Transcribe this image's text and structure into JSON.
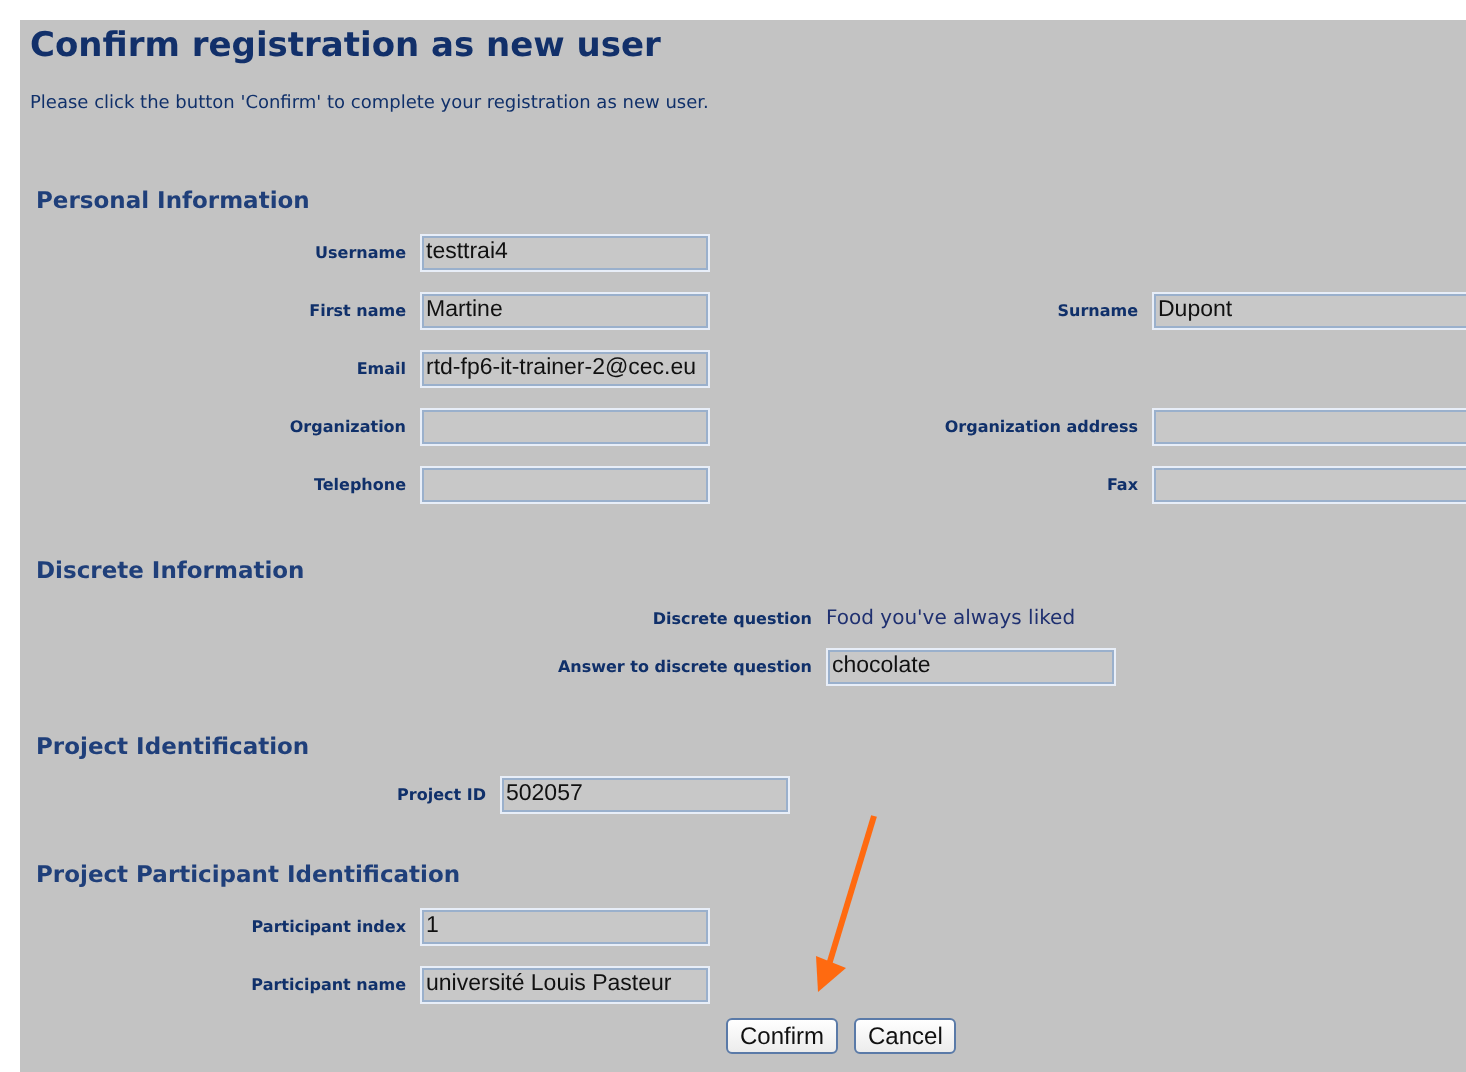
{
  "title": "Confirm registration as new user",
  "intro": "Please click the button 'Confirm' to complete your registration as new user.",
  "sections": [
    {
      "heading": "Personal Information",
      "rows": [
        [
          {
            "label": "Username",
            "kind": "field",
            "value": "testtrai4"
          }
        ],
        [
          {
            "label": "First name",
            "kind": "field",
            "value": "Martine"
          },
          {
            "label": "Surname",
            "kind": "field",
            "value": "Dupont"
          }
        ],
        [
          {
            "label": "Email",
            "kind": "field",
            "value": "rtd-fp6-it-trainer-2@cec.eu"
          }
        ],
        [
          {
            "label": "Organization",
            "kind": "field"
          },
          {
            "label": "Organization address",
            "kind": "field"
          }
        ],
        [
          {
            "label": "Telephone",
            "kind": "field"
          },
          {
            "label": "Fax",
            "kind": "field"
          }
        ]
      ]
    },
    {
      "heading": "Discrete Information",
      "rows": [
        [
          {
            "label": "Discrete question",
            "kind": "text",
            "value": "Food you've always liked"
          }
        ],
        [
          {
            "label": "Answer to discrete question",
            "kind": "field",
            "value": "chocolate"
          }
        ]
      ]
    },
    {
      "heading": "Project Identification",
      "rows": [
        [
          {
            "label": "Project ID",
            "kind": "field",
            "value": "502057"
          }
        ]
      ]
    },
    {
      "heading": "Project Participant Identification",
      "rows": [
        [
          {
            "label": "Participant index",
            "kind": "field",
            "value": "1"
          }
        ],
        [
          {
            "label": "Participant name",
            "kind": "field",
            "value": "université Louis Pasteur"
          }
        ]
      ]
    }
  ],
  "buttons": [
    "Confirm",
    "Cancel"
  ]
}
